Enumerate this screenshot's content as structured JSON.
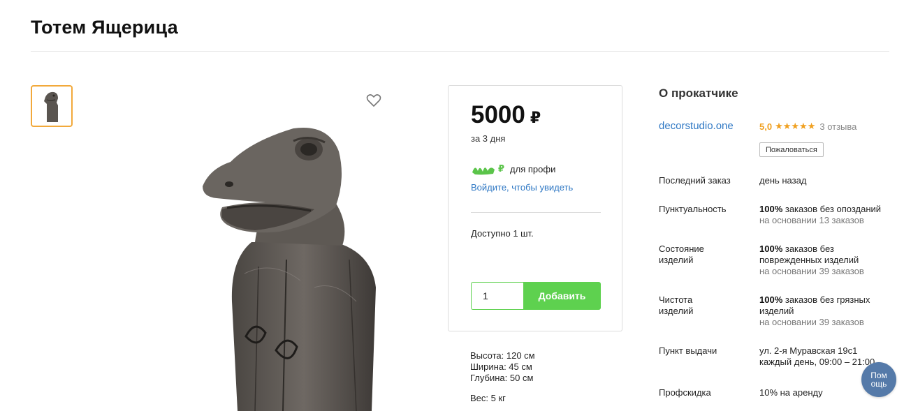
{
  "page": {
    "title": "Тотем Ящерица"
  },
  "gallery": {
    "thumbnail_icon": "lizard-totem-thumbnail",
    "favorite_icon": "heart-icon"
  },
  "price_card": {
    "price": "5000",
    "currency": "₽",
    "period": "за 3 дня",
    "pro_currency": "₽",
    "pro_label": "для профи",
    "login_link": "Войдите, чтобы увидеть",
    "availability": "Доступно 1 шт.",
    "quantity_value": "1",
    "add_button": "Добавить",
    "accent_color": "#5ed14f"
  },
  "specs": {
    "height": "Высота: 120 см",
    "width": "Ширина: 45 см",
    "depth": "Глубина: 50 см",
    "weight": "Вес: 5 кг"
  },
  "seller": {
    "section_title": "О прокатчике",
    "name": "decorstudio.one",
    "rating": "5,0",
    "stars": "★★★★★",
    "reviews": "3 отзыва",
    "complain_button": "Пожаловаться",
    "rows": [
      {
        "label": "Последний заказ",
        "value_bold": "",
        "value": "день назад",
        "sub": ""
      },
      {
        "label": "Пунктуальность",
        "value_bold": "100%",
        "value": " заказов без опозданий",
        "sub": "на основании 13 заказов"
      },
      {
        "label": "Состояние изделий",
        "value_bold": "100%",
        "value": " заказов без поврежденных изделий",
        "sub": "на основании 39 заказов"
      },
      {
        "label": "Чистота изделий",
        "value_bold": "100%",
        "value": " заказов без грязных изделий",
        "sub": "на основании 39 заказов"
      },
      {
        "label": "Пункт выдачи",
        "value_bold": "",
        "value": "ул. 2-я Муравская 19с1",
        "sub": "каждый день, 09:00 – 21:00"
      },
      {
        "label": "Профскидка",
        "value_bold": "",
        "value": "10% на аренду",
        "sub": ""
      }
    ]
  },
  "help_button": "Пом ощь"
}
